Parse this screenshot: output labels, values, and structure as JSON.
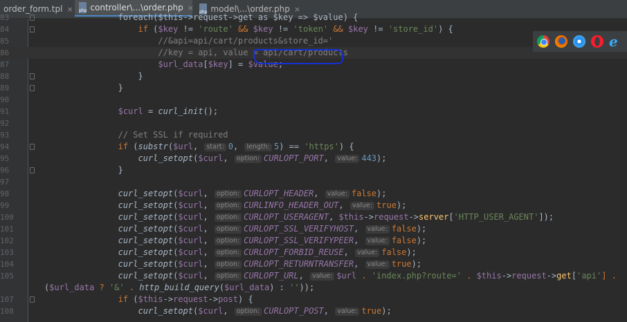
{
  "tabs": [
    {
      "label": "order_form.tpl",
      "type": "",
      "active": false
    },
    {
      "label": "controller\\...\\order.php",
      "type": "php",
      "active": true
    },
    {
      "label": "model\\...\\order.php",
      "type": "php",
      "active": false
    }
  ],
  "close_glyph": "×",
  "browser_icons": [
    "chrome-icon",
    "firefox-icon",
    "safari-icon",
    "opera-icon",
    "ie-icon"
  ],
  "ie_glyph": "e",
  "line_numbers": [
    "83",
    "84",
    "85",
    "86",
    "87",
    "88",
    "89",
    "90",
    "91",
    "92",
    "93",
    "94",
    "95",
    "96",
    "97",
    "98",
    "99",
    "100",
    "101",
    "102",
    "103",
    "104",
    "105",
    "",
    "107",
    "108"
  ],
  "code": {
    "l83": "foreach($this->request->get as $key => $value) {",
    "l84": {
      "kw": "if",
      "a": "$key",
      "b": " != ",
      "c": "'route'",
      "d": " && ",
      "e": "$key",
      "f": " != ",
      "g": "'token'",
      "h": " && ",
      "i": "$key",
      "j": " != ",
      "k": "'store_id'",
      "l": ") {"
    },
    "l85": "//&api=api/cart/products&store_id='",
    "l86": "//key = api, value = api/cart/products",
    "l87": {
      "a": "$url_data",
      "b": "[",
      "c": "$key",
      "d": "] = ",
      "e": "$value",
      "f": ";"
    },
    "l88": "}",
    "l89": "}",
    "l91": {
      "a": "$curl",
      "b": " = ",
      "c": "curl_init",
      "d": "();"
    },
    "l93": "// Set SSL if required",
    "l94": {
      "kw": "if",
      "b": " (",
      "c": "substr",
      "d": "(",
      "e": "$url",
      ",": ",",
      "h1": "start:",
      "v1": "0",
      ",2": ",",
      "h2": "length:",
      "v2": "5",
      "f": ") == ",
      "g": "'https'",
      "h": ") {"
    },
    "l95": {
      "fn": "curl_setopt",
      "a": "(",
      "v": "$curl",
      ",": ",",
      "h1": "option:",
      "c": "CURLOPT_PORT",
      ",2": ",",
      "h2": "value:",
      "n": "443",
      "e": ");"
    },
    "l96": "}",
    "setopt_rows": [
      {
        "opt": "CURLOPT_HEADER",
        "val": "false",
        "valClass": "kw"
      },
      {
        "opt": "CURLINFO_HEADER_OUT",
        "val": "true",
        "valClass": "kw"
      },
      {
        "opt": "CURLOPT_USERAGENT",
        "val": "",
        "valClass": "expr"
      },
      {
        "opt": "CURLOPT_SSL_VERIFYHOST",
        "val": "false",
        "valClass": "kw"
      },
      {
        "opt": "CURLOPT_SSL_VERIFYPEER",
        "val": "false",
        "valClass": "kw"
      },
      {
        "opt": "CURLOPT_FORBID_REUSE",
        "val": "false",
        "valClass": "kw"
      },
      {
        "opt": "CURLOPT_RETURNTRANSFER",
        "val": "true",
        "valClass": "kw"
      },
      {
        "opt": "CURLOPT_URL",
        "val": "",
        "valClass": "expr"
      }
    ],
    "setopt_fn": "curl_setopt",
    "setopt_var": "$curl",
    "hint_option": "option:",
    "hint_value": "value:",
    "useragent_expr": {
      "a": "$this",
      "b": "->",
      "c": "request",
      "d": "->",
      "e": "server",
      "f": "[",
      "g": "'HTTP_USER_AGENT'",
      "h": "]);"
    },
    "url_expr": {
      "a": "$url",
      "b": " . ",
      "c": "'index.php?route='",
      "d": " . ",
      "e": "$this",
      "f": "->",
      "g": "request",
      "h": "->",
      "i": "get",
      "j": "[",
      "k": "'api'",
      "l": "] ."
    },
    "l105b": {
      "a": "(",
      "b": "$url_data",
      "c": " ? ",
      "d": "'&'",
      "e": " . ",
      "f": "http_build_query",
      "g": "(",
      "h": "$url_data",
      "i": ") : ",
      "j": "''",
      "k": "));"
    },
    "l107": {
      "kw": "if",
      "b": " (",
      "c": "$this",
      "d": "->",
      "e": "request",
      "f": "->",
      "g": "post",
      "h": ") {"
    },
    "l108": {
      "pre": "curl_setopt",
      "a": "(",
      "v": "$curl",
      ",": ",",
      "h1": "option:",
      "c": "CURLOPT_POST",
      ",2": ",",
      "h2": "value:",
      "n": "true",
      "e": ");"
    }
  }
}
